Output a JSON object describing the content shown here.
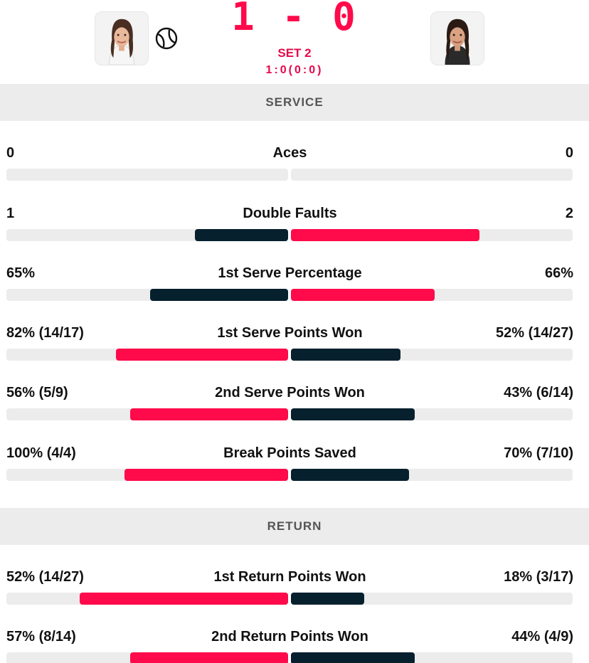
{
  "header": {
    "score": "1 - 0",
    "set_label": "SET 2",
    "set_score": "1:0(0:0)",
    "left_player": {
      "avatar_icon": "player-avatar",
      "serving": true
    },
    "right_player": {
      "avatar_icon": "player-avatar",
      "serving": false
    }
  },
  "colors": {
    "accent": "#ff0a4a",
    "dark": "#06202e",
    "track": "#ececec"
  },
  "sections": [
    {
      "title": "SERVICE",
      "stats": [
        {
          "label": "Aces",
          "left": "0",
          "right": "0",
          "left_fill": 0.0,
          "right_fill": 0.0,
          "left_color": "#06202e",
          "right_color": "#ff0a4a"
        },
        {
          "label": "Double Faults",
          "left": "1",
          "right": "2",
          "left_fill": 0.33,
          "right_fill": 0.67,
          "left_color": "#06202e",
          "right_color": "#ff0a4a"
        },
        {
          "label": "1st Serve Percentage",
          "left": "65%",
          "right": "66%",
          "left_fill": 0.49,
          "right_fill": 0.51,
          "left_color": "#06202e",
          "right_color": "#ff0a4a"
        },
        {
          "label": "1st Serve Points Won",
          "left": "82% (14/17)",
          "right": "52% (14/27)",
          "left_fill": 0.61,
          "right_fill": 0.39,
          "left_color": "#ff0a4a",
          "right_color": "#06202e"
        },
        {
          "label": "2nd Serve Points Won",
          "left": "56% (5/9)",
          "right": "43% (6/14)",
          "left_fill": 0.56,
          "right_fill": 0.44,
          "left_color": "#ff0a4a",
          "right_color": "#06202e"
        },
        {
          "label": "Break Points Saved",
          "left": "100% (4/4)",
          "right": "70% (7/10)",
          "left_fill": 0.58,
          "right_fill": 0.42,
          "left_color": "#ff0a4a",
          "right_color": "#06202e"
        }
      ]
    },
    {
      "title": "RETURN",
      "stats": [
        {
          "label": "1st Return Points Won",
          "left": "52% (14/27)",
          "right": "18% (3/17)",
          "left_fill": 0.74,
          "right_fill": 0.26,
          "left_color": "#ff0a4a",
          "right_color": "#06202e"
        },
        {
          "label": "2nd Return Points Won",
          "left": "57% (8/14)",
          "right": "44% (4/9)",
          "left_fill": 0.56,
          "right_fill": 0.44,
          "left_color": "#ff0a4a",
          "right_color": "#06202e"
        }
      ]
    }
  ]
}
